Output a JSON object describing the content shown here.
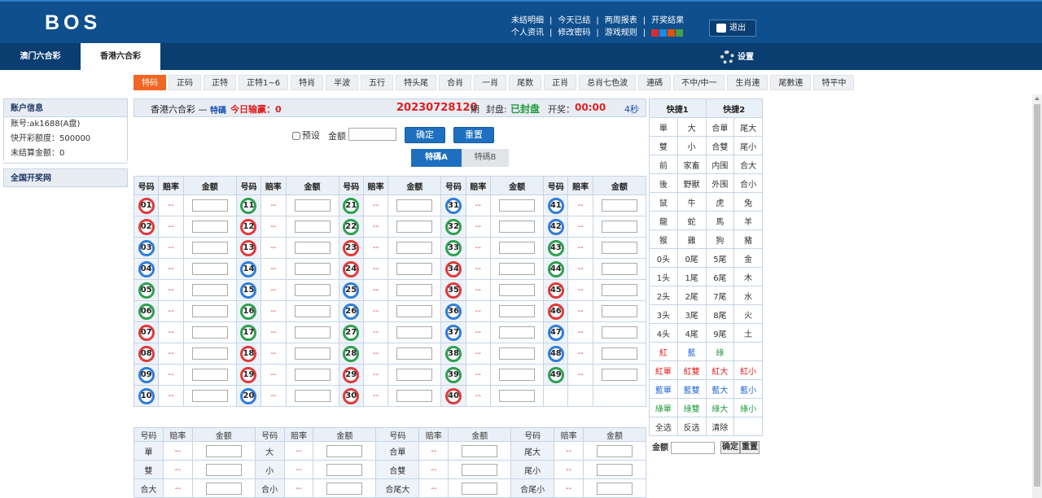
{
  "header": {
    "logo": "BOS",
    "links_row1": [
      "未结明细",
      "今天已结",
      "两周报表",
      "开奖结果"
    ],
    "links_row2": [
      "个人资讯",
      "修改密码",
      "游戏规则"
    ],
    "sep": "|",
    "theme_colors": [
      "#d32f2f",
      "#1e88e5",
      "#e65100",
      "#43a047"
    ],
    "logout": "退出"
  },
  "tabs": [
    "澳门六合彩",
    "香港六合彩"
  ],
  "settings": "设置",
  "bet_types": [
    "特码",
    "正码",
    "正特",
    "正特1~6",
    "特肖",
    "半波",
    "五行",
    "特头尾",
    "合肖",
    "一肖",
    "尾数",
    "正肖",
    "总肖七色波",
    "連碼",
    "不中/中一",
    "生肖連",
    "尾數連",
    "特平中"
  ],
  "account": {
    "title": "账户信息",
    "account_id": "账号:ak1688(A盘)",
    "quota": "快开彩额度：500000",
    "unsettled": "未结算金额：0",
    "results_link": "全国开奖网"
  },
  "panel": {
    "game": "香港六合彩 —",
    "type": "特碼",
    "today": "今日输赢：0",
    "issue": "20230728120",
    "issue_suffix": "期",
    "status_label": "封盘:",
    "status": "已封盘",
    "draw_label": "开奖：",
    "draw_time": "00:00",
    "countdown": "4秒"
  },
  "controls": {
    "preset": "预设",
    "amount_label": "金额",
    "confirm": "确定",
    "reset": "重置"
  },
  "subtabs": [
    "特碼A",
    "特碼B"
  ],
  "grid_headers": [
    "号码",
    "赔率",
    "金额"
  ],
  "odds_placeholder": "--",
  "numbers": [
    [
      "01",
      "red"
    ],
    [
      "02",
      "red"
    ],
    [
      "03",
      "blue"
    ],
    [
      "04",
      "blue"
    ],
    [
      "05",
      "green"
    ],
    [
      "06",
      "green"
    ],
    [
      "07",
      "red"
    ],
    [
      "08",
      "red"
    ],
    [
      "09",
      "blue"
    ],
    [
      "10",
      "blue"
    ],
    [
      "11",
      "green"
    ],
    [
      "12",
      "red"
    ],
    [
      "13",
      "red"
    ],
    [
      "14",
      "blue"
    ],
    [
      "15",
      "blue"
    ],
    [
      "16",
      "green"
    ],
    [
      "17",
      "green"
    ],
    [
      "18",
      "red"
    ],
    [
      "19",
      "red"
    ],
    [
      "20",
      "blue"
    ],
    [
      "21",
      "green"
    ],
    [
      "22",
      "green"
    ],
    [
      "23",
      "red"
    ],
    [
      "24",
      "red"
    ],
    [
      "25",
      "blue"
    ],
    [
      "26",
      "blue"
    ],
    [
      "27",
      "green"
    ],
    [
      "28",
      "green"
    ],
    [
      "29",
      "red"
    ],
    [
      "30",
      "red"
    ],
    [
      "31",
      "blue"
    ],
    [
      "32",
      "green"
    ],
    [
      "33",
      "green"
    ],
    [
      "34",
      "red"
    ],
    [
      "35",
      "red"
    ],
    [
      "36",
      "blue"
    ],
    [
      "37",
      "blue"
    ],
    [
      "38",
      "green"
    ],
    [
      "39",
      "green"
    ],
    [
      "40",
      "red"
    ],
    [
      "41",
      "blue"
    ],
    [
      "42",
      "blue"
    ],
    [
      "43",
      "green"
    ],
    [
      "44",
      "green"
    ],
    [
      "45",
      "red"
    ],
    [
      "46",
      "red"
    ],
    [
      "47",
      "blue"
    ],
    [
      "48",
      "blue"
    ],
    [
      "49",
      "green"
    ]
  ],
  "extra_headers": [
    "号码",
    "赔率",
    "金额"
  ],
  "extra_rows": [
    [
      "單",
      "大",
      "合單",
      "尾大"
    ],
    [
      "雙",
      "小",
      "合雙",
      "尾小"
    ],
    [
      "合大",
      "合小",
      "合尾大",
      "合尾小"
    ]
  ],
  "quick": {
    "headers": [
      "快捷1",
      "快捷2"
    ],
    "rows": [
      [
        [
          "單",
          ""
        ],
        [
          "大",
          ""
        ],
        [
          "合單",
          ""
        ],
        [
          "尾大",
          ""
        ]
      ],
      [
        [
          "雙",
          ""
        ],
        [
          "小",
          ""
        ],
        [
          "合雙",
          ""
        ],
        [
          "尾小",
          ""
        ]
      ],
      [
        [
          "前",
          ""
        ],
        [
          "家畜",
          ""
        ],
        [
          "内围",
          ""
        ],
        [
          "合大",
          ""
        ]
      ],
      [
        [
          "後",
          ""
        ],
        [
          "野獸",
          ""
        ],
        [
          "外围",
          ""
        ],
        [
          "合小",
          ""
        ]
      ],
      [
        [
          "鼠",
          ""
        ],
        [
          "牛",
          ""
        ],
        [
          "虎",
          ""
        ],
        [
          "兔",
          ""
        ]
      ],
      [
        [
          "龍",
          ""
        ],
        [
          "蛇",
          ""
        ],
        [
          "馬",
          ""
        ],
        [
          "羊",
          ""
        ]
      ],
      [
        [
          "猴",
          ""
        ],
        [
          "雞",
          ""
        ],
        [
          "狗",
          ""
        ],
        [
          "豬",
          ""
        ]
      ],
      [
        [
          "0头",
          ""
        ],
        [
          "0尾",
          ""
        ],
        [
          "5尾",
          ""
        ],
        [
          "金",
          ""
        ]
      ],
      [
        [
          "1头",
          ""
        ],
        [
          "1尾",
          ""
        ],
        [
          "6尾",
          ""
        ],
        [
          "木",
          ""
        ]
      ],
      [
        [
          "2头",
          ""
        ],
        [
          "2尾",
          ""
        ],
        [
          "7尾",
          ""
        ],
        [
          "水",
          ""
        ]
      ],
      [
        [
          "3头",
          ""
        ],
        [
          "3尾",
          ""
        ],
        [
          "8尾",
          ""
        ],
        [
          "火",
          ""
        ]
      ],
      [
        [
          "4头",
          ""
        ],
        [
          "4尾",
          ""
        ],
        [
          "9尾",
          ""
        ],
        [
          "土",
          ""
        ]
      ],
      [
        [
          "紅",
          "cr"
        ],
        [
          "藍",
          "cb"
        ],
        [
          "綠",
          "cg"
        ],
        [
          "",
          ""
        ]
      ],
      [
        [
          "紅單",
          "cr"
        ],
        [
          "紅雙",
          "cr"
        ],
        [
          "紅大",
          "cr"
        ],
        [
          "紅小",
          "cr"
        ]
      ],
      [
        [
          "藍單",
          "cb"
        ],
        [
          "藍雙",
          "cb"
        ],
        [
          "藍大",
          "cb"
        ],
        [
          "藍小",
          "cb"
        ]
      ],
      [
        [
          "綠單",
          "cg"
        ],
        [
          "綠雙",
          "cg"
        ],
        [
          "綠大",
          "cg"
        ],
        [
          "綠小",
          "cg"
        ]
      ],
      [
        [
          "全选",
          ""
        ],
        [
          "反选",
          ""
        ],
        [
          "清除",
          ""
        ],
        [
          "",
          ""
        ]
      ]
    ],
    "amount_label": "金额",
    "confirm": "确定",
    "reset": "重置"
  }
}
